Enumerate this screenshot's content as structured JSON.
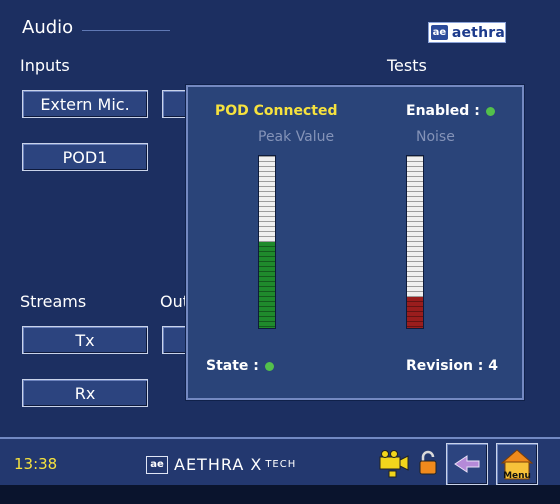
{
  "header": {
    "title": "Audio",
    "logo_mark": "ae",
    "logo_text": "aethra"
  },
  "sections": {
    "inputs_label": "Inputs",
    "tests_label": "Tests",
    "streams_label": "Streams",
    "outputs_label_partial": "Out"
  },
  "buttons": {
    "extern_mic": "Extern Mic.",
    "pod1": "POD1",
    "tx": "Tx",
    "rx": "Rx"
  },
  "popup": {
    "status": "POD Connected",
    "enabled_label": "Enabled :",
    "peak_label": "Peak Value",
    "noise_label": "Noise",
    "peak_level": 0.5,
    "noise_level": 0.18,
    "peak_color": "#1f8a2c",
    "noise_color": "#9a1d1d",
    "state_label": "State :",
    "revision_label": "Revision : 4"
  },
  "footer": {
    "time": "13:38",
    "brand_mark": "ae",
    "brand_name": "AETHRA X",
    "brand_tech": "TECH",
    "menu_label": "Menu"
  },
  "colors": {
    "accent_yellow": "#f6e23e",
    "led_green": "#53c04b",
    "background": "#1c2f61"
  },
  "icons": [
    "camera-icon",
    "lock-icon",
    "back-arrow-icon",
    "home-menu-icon"
  ]
}
